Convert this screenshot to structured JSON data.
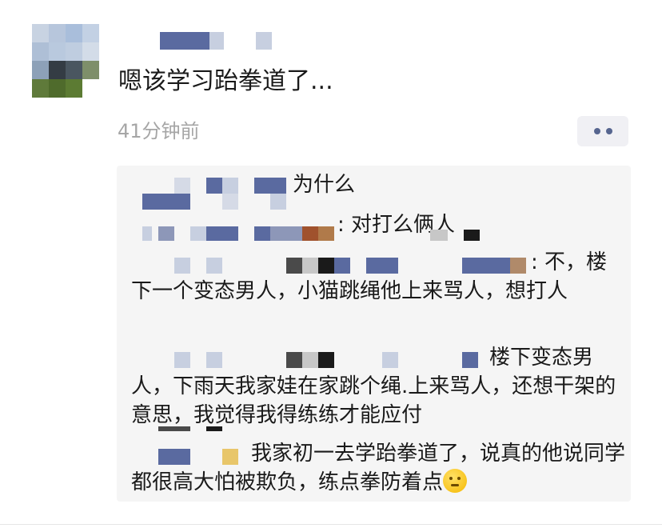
{
  "post": {
    "text": "嗯该学习跆拳道了...",
    "time": "41分钟前"
  },
  "more_button": {
    "icon": "more-dots-icon"
  },
  "comments": [
    {
      "text": "为什么"
    },
    {
      "text": ": 对打么俩人"
    },
    {
      "text": ": 不，楼下一个变态男人，小猫跳绳他上来骂人，想打人"
    },
    {
      "text": "楼下变态男人，下雨天我家娃在家跳个绳.上来骂人，还想干架的意思，我觉得我得练练才能应付"
    },
    {
      "text": "我家初一去学跆拳道了，说真的他说同学都很高大怕被欺负，练点拳防着点"
    }
  ],
  "emoji": "thinking-face-icon",
  "colors": {
    "name_blur": "#5a6aa0",
    "time_gray": "#a6a6a6",
    "comment_bg": "#f5f5f5",
    "button_bg": "#f0f0f4"
  }
}
